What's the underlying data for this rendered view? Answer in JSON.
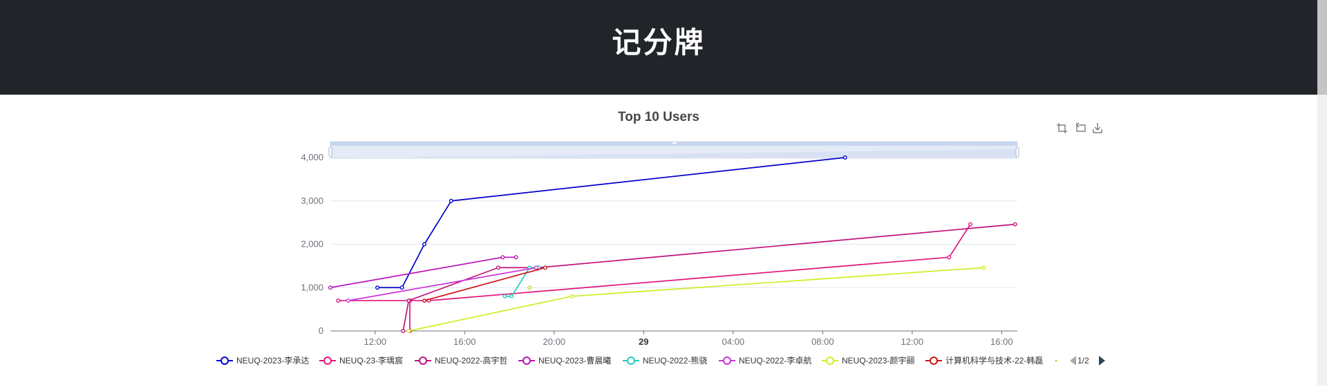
{
  "page": {
    "title": "记分牌"
  },
  "toolbox": {
    "icons": [
      "zoom-icon",
      "zoom-reset-icon",
      "download-icon"
    ]
  },
  "legend": {
    "page": "1/2"
  },
  "chart_data": {
    "type": "line",
    "title": "Top 10 Users",
    "xlabel": "",
    "ylabel": "",
    "ylim": [
      0,
      4000
    ],
    "y_ticks": [
      "0",
      "1,000",
      "2,000",
      "3,000",
      "4,000"
    ],
    "x_ticks": [
      "12:00",
      "16:00",
      "20:00",
      "29",
      "04:00",
      "08:00",
      "12:00",
      "16:00"
    ],
    "x_tick_hours": [
      12,
      16,
      20,
      24,
      28,
      32,
      36,
      40
    ],
    "x_range_hours": [
      10,
      40.7
    ],
    "grid": true,
    "legend_position": "bottom",
    "has_data_zoom": true,
    "series": [
      {
        "name": "NEUQ-2023-李承达",
        "color": "#0000cc",
        "points": [
          [
            12.1,
            1000
          ],
          [
            13.2,
            1000
          ],
          [
            14.2,
            2000
          ],
          [
            15.4,
            3000
          ],
          [
            33.0,
            4000
          ]
        ]
      },
      {
        "name": "NEUQ-23-李瑀宸",
        "color": "#e0137a",
        "points": [
          [
            10.35,
            700
          ],
          [
            13.55,
            700
          ],
          [
            13.55,
            0
          ],
          [
            13.55,
            700
          ],
          [
            14.4,
            700
          ],
          [
            37.65,
            1700
          ],
          [
            38.6,
            2460
          ]
        ]
      },
      {
        "name": "NEUQ-2022-高宇哲",
        "color": "#c0117a",
        "points": [
          [
            13.25,
            0
          ],
          [
            13.5,
            700
          ],
          [
            17.5,
            1460
          ],
          [
            19.3,
            1460
          ],
          [
            40.6,
            2460
          ]
        ]
      },
      {
        "name": "NEUQ-2023-曹晨曦",
        "color": "#bb11bb",
        "points": [
          [
            10,
            1000
          ],
          [
            17.7,
            1700
          ],
          [
            18.3,
            1700
          ]
        ]
      },
      {
        "name": "NEUQ-2022-熊骁",
        "color": "#22ccbb",
        "points": [
          [
            17.8,
            800
          ],
          [
            18.1,
            800
          ],
          [
            18.9,
            1460
          ],
          [
            19.3,
            1460
          ]
        ]
      },
      {
        "name": "NEUQ-2022-李卓航",
        "color": "#cc33dd",
        "points": [
          [
            10.8,
            700
          ],
          [
            19.2,
            1460
          ]
        ]
      },
      {
        "name": "NEUQ-2023-颜宇翮",
        "color": "#ccee22",
        "points": [
          [
            13.5,
            0
          ],
          [
            20.8,
            800
          ],
          [
            39.2,
            1460
          ]
        ]
      },
      {
        "name": "计算机科学与技术-22-韩磊",
        "color": "#cc1111",
        "points": [
          [
            14.2,
            700
          ],
          [
            19.6,
            1460
          ]
        ]
      },
      {
        "name": "",
        "color": "#aadd44",
        "points": [
          [
            18.9,
            1000
          ]
        ]
      }
    ]
  }
}
